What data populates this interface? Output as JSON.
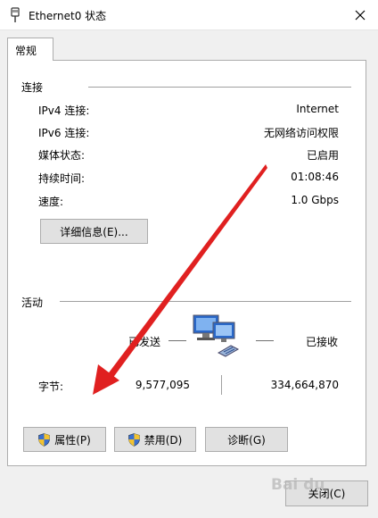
{
  "window": {
    "title": "Ethernet0 状态",
    "close_icon": "close-icon"
  },
  "tabs": [
    {
      "label": "常规"
    }
  ],
  "connection": {
    "group_label": "连接",
    "rows": [
      {
        "label": "IPv4 连接:",
        "value": "Internet"
      },
      {
        "label": "IPv6 连接:",
        "value": "无网络访问权限"
      },
      {
        "label": "媒体状态:",
        "value": "已启用"
      },
      {
        "label": "持续时间:",
        "value": "01:08:46"
      },
      {
        "label": "速度:",
        "value": "1.0 Gbps"
      }
    ],
    "details_button": "详细信息(E)..."
  },
  "activity": {
    "group_label": "活动",
    "sent_label": "已发送",
    "received_label": "已接收",
    "bytes_label": "字节:",
    "bytes_sent": "9,577,095",
    "bytes_received": "334,664,870",
    "network_icon": "network-computers-icon"
  },
  "buttons": {
    "properties": "属性(P)",
    "disable": "禁用(D)",
    "diagnose": "诊断(G)",
    "close": "关闭(C)"
  },
  "colors": {
    "arrow": "#e02020",
    "shield_blue": "#3a6fd0",
    "shield_yellow": "#f2c230"
  }
}
